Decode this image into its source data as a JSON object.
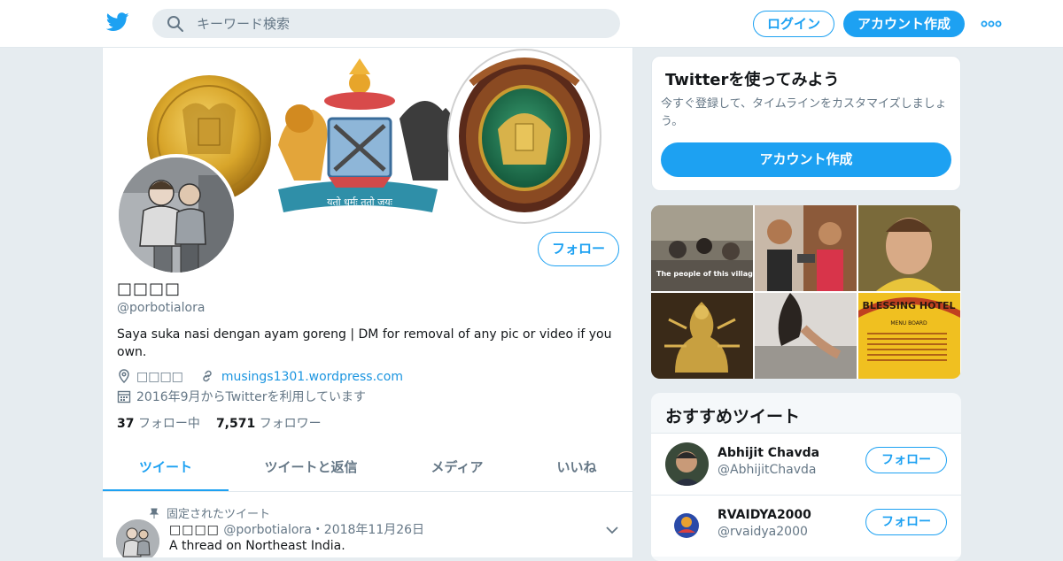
{
  "topbar": {
    "search_placeholder": "キーワード検索",
    "login_label": "ログイン",
    "signup_label": "アカウント作成"
  },
  "profile": {
    "name": "□□□□",
    "handle": "@porbotialora",
    "bio": "Saya suka nasi dengan ayam goreng | DM for removal of any pic or video if you own.",
    "location": "□□□□",
    "website": "musings1301.wordpress.com",
    "joined": "2016年9月からTwitterを利用しています",
    "following_count": "37",
    "following_label": "フォロー中",
    "followers_count": "7,571",
    "followers_label": "フォロワー",
    "follow_label": "フォロー",
    "banner_motto": "यतो धर्मः ततो जयः"
  },
  "tabs": [
    {
      "label": "ツイート",
      "active": true
    },
    {
      "label": "ツイートと返信",
      "active": false
    },
    {
      "label": "メディア",
      "active": false
    },
    {
      "label": "いいね",
      "active": false
    }
  ],
  "pinned_tweet": {
    "pinned_label": "固定されたツイート",
    "name": "□□□□",
    "handle": "@porbotialora",
    "date": "・2018年11月26日",
    "text": "A thread on Northeast India."
  },
  "signup_card": {
    "title": "Twitterを使ってみよう",
    "subtitle": "今すぐ登録して、タイムラインをカスタマイズしましょう。",
    "button_label": "アカウント作成"
  },
  "media_grid": {
    "tile1_caption": "The people of this village have dual",
    "tile6_title": "BLESSING HOTEL",
    "tile6_sub": "MENU BOARD"
  },
  "recommended": {
    "title": "おすすめツイート",
    "users": [
      {
        "name": "Abhijit Chavda",
        "handle": "@AbhijitChavda",
        "follow_label": "フォロー"
      },
      {
        "name": "RVAIDYA2000",
        "handle": "@rvaidya2000",
        "follow_label": "フォロー"
      }
    ]
  },
  "colors": {
    "accent": "#1da1f2",
    "background": "#e6ecf0",
    "muted_text": "#657786"
  }
}
